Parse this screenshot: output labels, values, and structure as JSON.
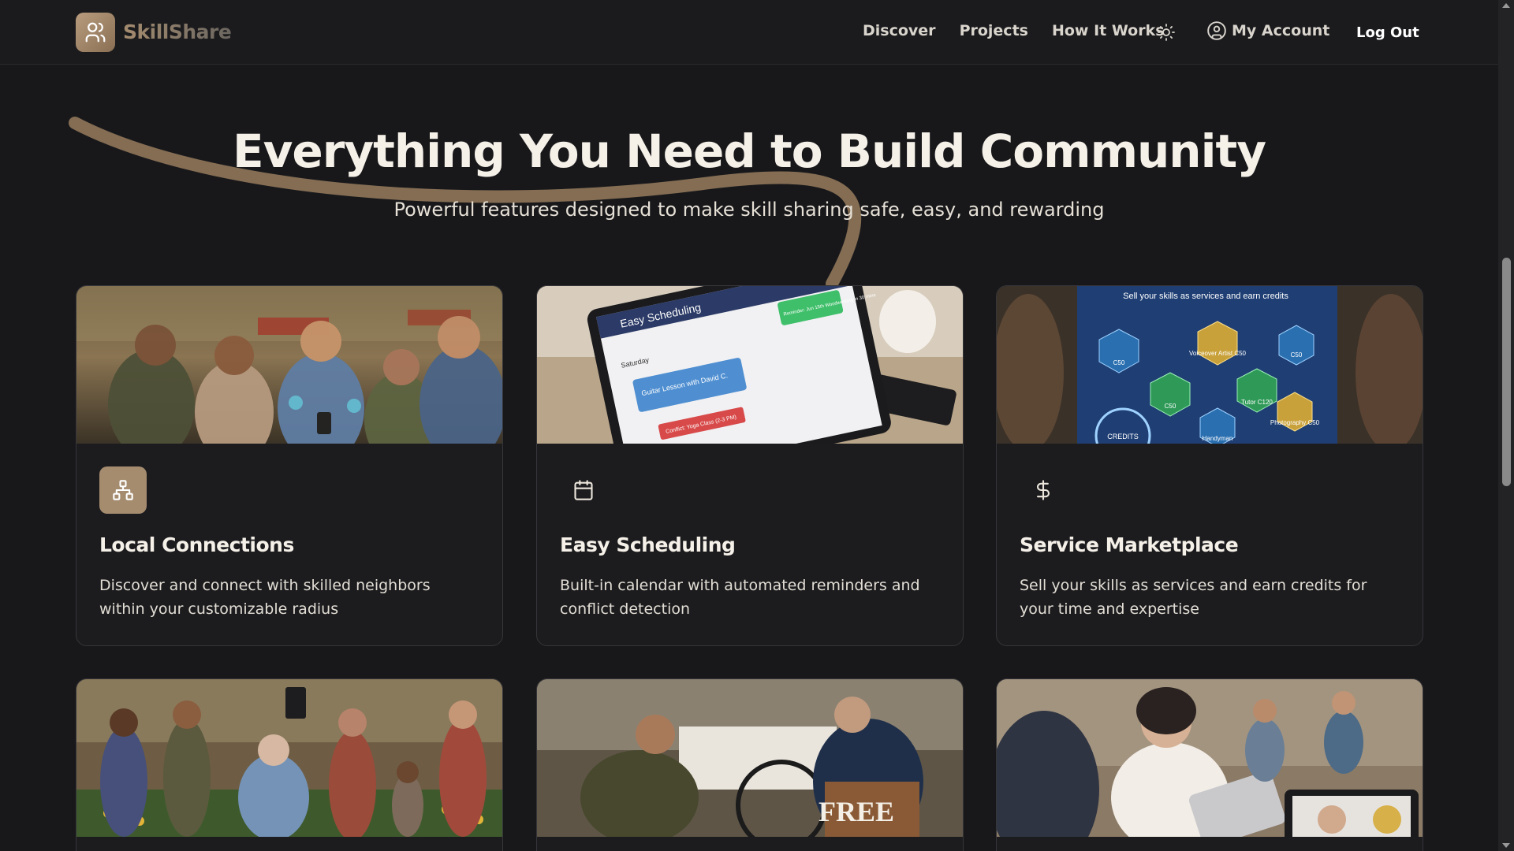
{
  "brand": {
    "name": "SkillShare"
  },
  "nav": {
    "links": [
      "Discover",
      "Projects",
      "How It Works"
    ],
    "account_label": "My Account",
    "logout_label": "Log Out"
  },
  "hero": {
    "title": "Everything You Need to Build Community",
    "subtitle": "Powerful features designed to make skill sharing safe, easy, and rewarding"
  },
  "features": [
    {
      "title": "Local Connections",
      "description": "Discover and connect with skilled neighbors within your customizable radius",
      "icon": "network-icon"
    },
    {
      "title": "Easy Scheduling",
      "description": "Built-in calendar with automated reminders and conflict detection",
      "icon": "calendar-icon"
    },
    {
      "title": "Service Marketplace",
      "description": "Sell your skills as services and earn credits for your time and expertise",
      "icon": "dollar-icon"
    }
  ],
  "card_images": {
    "scheduling": {
      "header": "Easy Scheduling",
      "day": "Saturday",
      "event": "Guitar Lesson with David C.",
      "conflict": "Conflict: Yoga Class (2-3 PM)",
      "reminder": "Reminder: Jun 15th Woodworking in 30 mins"
    },
    "marketplace": {
      "banner": "Sell your skills as services and earn credits",
      "credits": "CREDITS",
      "hex_labels": [
        "C50",
        "Voiceover Artist C50",
        "C50",
        "C50",
        "Tutor C120",
        "Handyman",
        "Photography C50"
      ]
    },
    "volunteer": {
      "sign": "FREE"
    }
  },
  "colors": {
    "accent": "#a58c6f",
    "background": "#18181b",
    "card": "#1c1c1f"
  }
}
